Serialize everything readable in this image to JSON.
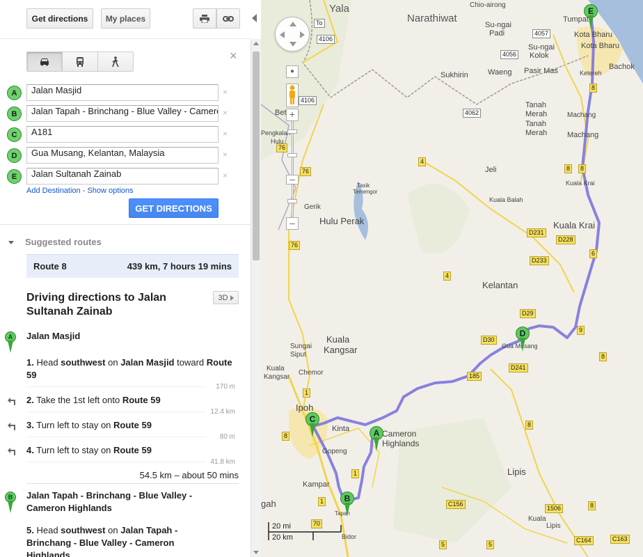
{
  "toolbar": {
    "get_directions": "Get directions",
    "my_places": "My places",
    "print_icon": "printer-icon",
    "link_icon": "link-icon"
  },
  "modes": [
    {
      "name": "car-icon",
      "active": true
    },
    {
      "name": "transit-icon",
      "active": false
    },
    {
      "name": "walk-icon",
      "active": false
    }
  ],
  "close": "×",
  "waypoints": [
    {
      "letter": "A",
      "value": "Jalan Masjid"
    },
    {
      "letter": "B",
      "value": "Jalan Tapah - Brinchang - Blue Valley - Cameron Highlands"
    },
    {
      "letter": "C",
      "value": "A181"
    },
    {
      "letter": "D",
      "value": "Gua Musang, Kelantan, Malaysia"
    },
    {
      "letter": "E",
      "value": "Jalan Sultanah Zainab"
    }
  ],
  "delete_symbol": "×",
  "options": {
    "add_destination": "Add Destination",
    "separator": "-",
    "show_options": "Show options"
  },
  "get_directions_button": "GET DIRECTIONS",
  "suggested": {
    "heading": "Suggested routes",
    "route_name": "Route 8",
    "route_summary": "439 km, 7 hours 19 mins"
  },
  "directions": {
    "title": "Driving directions to Jalan Sultanah Zainab",
    "btn_3d": "3D",
    "wp_a_title": "Jalan Masjid",
    "wp_a_letter": "A",
    "steps": [
      {
        "num": "1.",
        "pre": "Head",
        "b1": "southwest",
        "mid": "on",
        "b2": "Jalan Masjid",
        "post": "toward",
        "b3": "Route 59",
        "dist": "170 m"
      },
      {
        "num": "2.",
        "text": "Take the 1st left onto",
        "b": "Route 59",
        "dist": "12.4 km"
      },
      {
        "num": "3.",
        "text": "Turn left to stay on",
        "b": "Route 59",
        "dist": "80 m"
      },
      {
        "num": "4.",
        "text": "Turn left to stay on",
        "b": "Route 59",
        "dist": "41.8 km"
      }
    ],
    "seg_total": "54.5 km – about 50 mins",
    "wp_b_title": "Jalan Tapah - Brinchang - Blue Valley - Cameron Highlands",
    "wp_b_letter": "B",
    "step5": {
      "num": "5.",
      "pre": "Head",
      "b1": "southwest",
      "mid": "on",
      "b2": "Jalan Tapah - Brinchang - Blue Valley - Cameron Highlands"
    }
  },
  "map": {
    "labels": [
      {
        "t": "Yala",
        "c": "big"
      },
      {
        "t": "Narathiwat",
        "c": "big"
      },
      {
        "t": "Chio-airong",
        "c": ""
      },
      {
        "t": "Tumpat",
        "c": ""
      },
      {
        "t": "Kota Bharu",
        "c": ""
      },
      {
        "t": "Kota Bharu",
        "c": ""
      },
      {
        "t": "Su-ngai",
        "c": ""
      },
      {
        "t": "Padi",
        "c": ""
      },
      {
        "t": "Su-ngai",
        "c": ""
      },
      {
        "t": "Kolok",
        "c": ""
      },
      {
        "t": "Pasir Mas",
        "c": ""
      },
      {
        "t": "Bachok",
        "c": ""
      },
      {
        "t": "Ketereh",
        "c": ""
      },
      {
        "t": "Sukhirin",
        "c": ""
      },
      {
        "t": "Waeng",
        "c": ""
      },
      {
        "t": "Tanah",
        "c": ""
      },
      {
        "t": "Merah",
        "c": ""
      },
      {
        "t": "Tanah",
        "c": ""
      },
      {
        "t": "Merah",
        "c": ""
      },
      {
        "t": "Machang",
        "c": ""
      },
      {
        "t": "Machang",
        "c": ""
      },
      {
        "t": "Jeli",
        "c": ""
      },
      {
        "t": "Kuala Krai",
        "c": ""
      },
      {
        "t": "Kuala Krai",
        "c": "mid"
      },
      {
        "t": "Kuala Balah",
        "c": ""
      },
      {
        "t": "Tasik",
        "c": ""
      },
      {
        "t": "Temengor",
        "c": ""
      },
      {
        "t": "Gerik",
        "c": ""
      },
      {
        "t": "Hulu Perak",
        "c": "mid"
      },
      {
        "t": "Kelantan",
        "c": "mid"
      },
      {
        "t": "Gua Musang",
        "c": ""
      },
      {
        "t": "Sungai",
        "c": ""
      },
      {
        "t": "Siput",
        "c": ""
      },
      {
        "t": "Kuala",
        "c": "mid"
      },
      {
        "t": "Kangsar",
        "c": "mid"
      },
      {
        "t": "Kuala",
        "c": ""
      },
      {
        "t": "Kangsar",
        "c": ""
      },
      {
        "t": "Chemor",
        "c": ""
      },
      {
        "t": "Ipoh",
        "c": "mid"
      },
      {
        "t": "Kinta",
        "c": ""
      },
      {
        "t": "Cameron",
        "c": "mid"
      },
      {
        "t": "Highlands",
        "c": "mid"
      },
      {
        "t": "Gopeng",
        "c": ""
      },
      {
        "t": "Kampar",
        "c": ""
      },
      {
        "t": "Tapah",
        "c": ""
      },
      {
        "t": "Bidor",
        "c": ""
      },
      {
        "t": "gah",
        "c": "mid"
      },
      {
        "t": "Lipis",
        "c": "mid"
      },
      {
        "t": "Kuala",
        "c": ""
      },
      {
        "t": "Lipis",
        "c": ""
      },
      {
        "t": "Pengkalan",
        "c": ""
      },
      {
        "t": "Hulu",
        "c": ""
      },
      {
        "t": "Betong",
        "c": ""
      }
    ],
    "shields": [
      "To",
      "4106",
      "4057",
      "4056",
      "4062",
      "4106",
      "76",
      "76",
      "4",
      "4",
      "76",
      "8",
      "8",
      "8",
      "8",
      "D231",
      "D228",
      "D233",
      "D29",
      "D30",
      "185",
      "D241",
      "8",
      "1",
      "1",
      "1",
      "70",
      "8",
      "5",
      "C156",
      "1506",
      "C164",
      "C163",
      "8",
      "5",
      "9",
      "6"
    ],
    "scale_mi": "20 mi",
    "scale_km": "20 km",
    "pins": [
      "A",
      "B",
      "C",
      "D",
      "E"
    ]
  }
}
